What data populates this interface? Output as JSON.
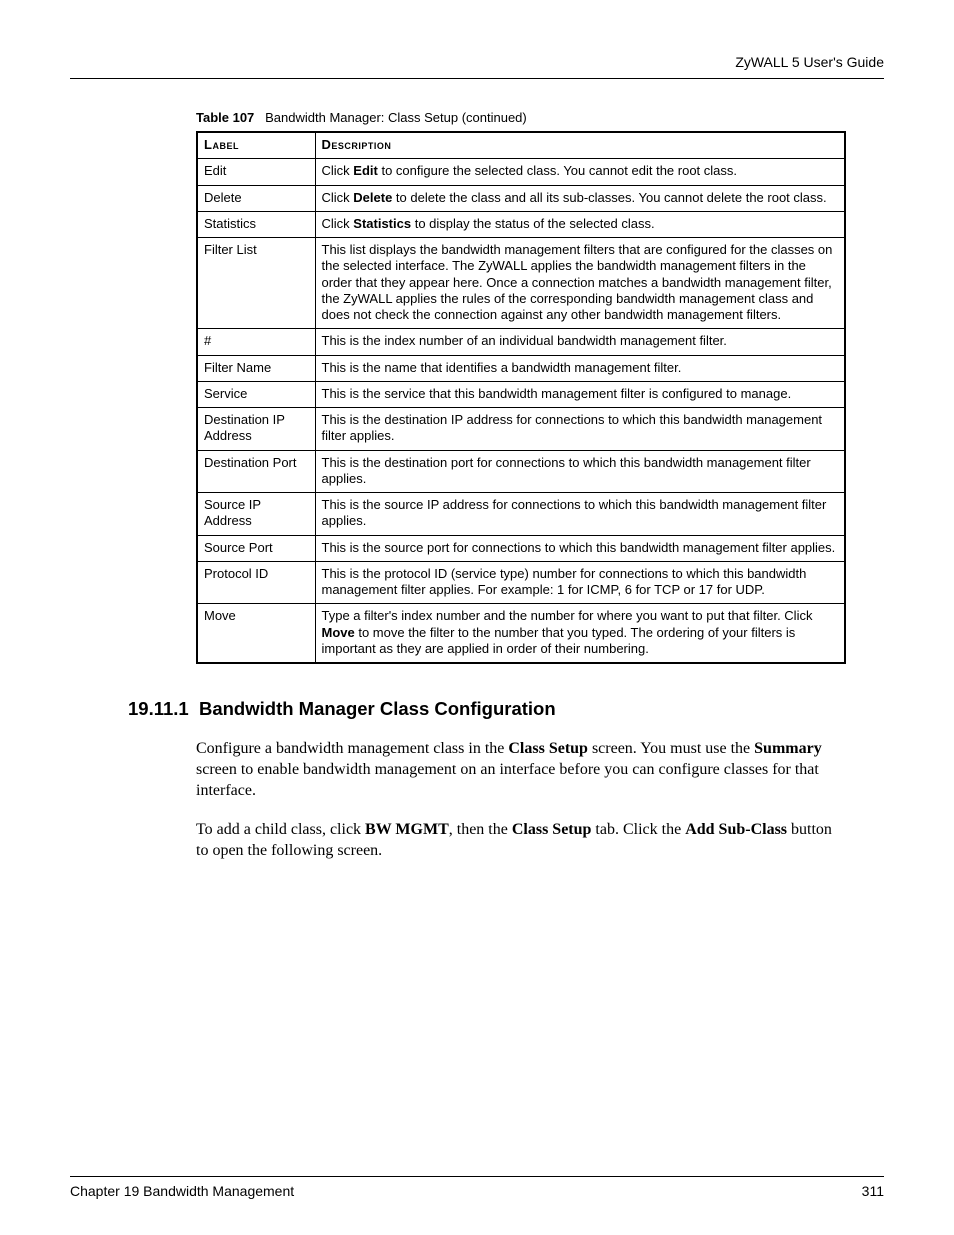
{
  "header": {
    "guide_title": "ZyWALL 5 User's Guide"
  },
  "table": {
    "caption_prefix": "Table 107",
    "caption_text": "Bandwidth Manager: Class Setup (continued)",
    "columns": {
      "label": "Label",
      "description": "Description"
    },
    "rows": [
      {
        "label": "Edit",
        "desc_before": "Click ",
        "desc_bold": "Edit",
        "desc_after": " to configure the selected class. You cannot edit the root class."
      },
      {
        "label": "Delete",
        "desc_before": "Click ",
        "desc_bold": "Delete",
        "desc_after": " to delete the class and all its sub-classes. You cannot delete the root class."
      },
      {
        "label": "Statistics",
        "desc_before": "Click ",
        "desc_bold": "Statistics",
        "desc_after": " to display the status of the selected class."
      },
      {
        "label": "Filter List",
        "desc_plain": "This list displays the bandwidth management filters that are configured for the classes on the selected interface. The ZyWALL applies the bandwidth management filters in the order that they appear here. Once a connection matches a bandwidth management filter, the ZyWALL applies the rules of the corresponding bandwidth management class and does not check the connection against any other bandwidth management filters."
      },
      {
        "label": "#",
        "desc_plain": "This is the index number of an individual bandwidth management filter."
      },
      {
        "label": "Filter Name",
        "desc_plain": "This is the name that identifies a bandwidth management filter."
      },
      {
        "label": "Service",
        "desc_plain": "This is the service that this bandwidth management filter is configured to manage."
      },
      {
        "label": "Destination IP Address",
        "desc_plain": "This is the destination IP address for connections to which this bandwidth management filter applies."
      },
      {
        "label": "Destination Port",
        "desc_plain": "This is the destination port for connections to which this bandwidth management filter applies."
      },
      {
        "label": "Source IP Address",
        "desc_plain": "This is the source IP address for connections to which this bandwidth management filter applies."
      },
      {
        "label": "Source Port",
        "desc_plain": "This is the source port for connections to which this bandwidth management filter applies."
      },
      {
        "label": "Protocol ID",
        "desc_plain": "This is the protocol ID (service type) number for connections to which this bandwidth management filter applies. For example: 1 for ICMP, 6 for TCP or 17 for UDP."
      },
      {
        "label": "Move",
        "desc_before": "Type a filter's index number and the number for where you want to put that filter. Click ",
        "desc_bold": "Move",
        "desc_after": " to move the filter to the number that you typed. The ordering of your filters is important as they are applied in order of their numbering."
      }
    ]
  },
  "section": {
    "number": "19.11.1",
    "title": "Bandwidth Manager Class Configuration",
    "para1": {
      "t1": "Configure a bandwidth management class in the ",
      "b1": "Class Setup",
      "t2": " screen. You must use the ",
      "b2": "Summary",
      "t3": " screen to enable bandwidth management on an interface before you can configure classes for that interface."
    },
    "para2": {
      "t1": "To add a child class, click ",
      "b1": "BW MGMT",
      "t2": ", then the ",
      "b2": "Class Setup",
      "t3": " tab. Click the ",
      "b3": "Add Sub-Class",
      "t4": " button to open the following screen."
    }
  },
  "footer": {
    "chapter": "Chapter 19 Bandwidth Management",
    "page": "311"
  }
}
